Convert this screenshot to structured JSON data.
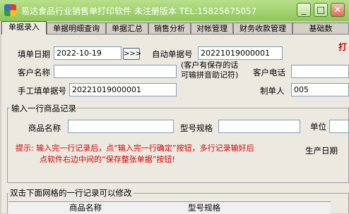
{
  "window": {
    "title": "易达食品行业销售单打印软件  未注册版本 TEL:15825675057",
    "minimize_glyph": "_",
    "maximize_glyph": "□",
    "close_glyph": "✕"
  },
  "tabs": [
    "单据录入",
    "单据明细查询",
    "单据汇总",
    "销售分析",
    "对帐管理",
    "财务收款管理",
    "基础数"
  ],
  "form": {
    "date_label": "填单日期",
    "date_value": "2022-10-19",
    "date_button": ">>>",
    "auto_no_label": "自动单据号",
    "auto_no_value": "20221019000001",
    "customer_label": "客户名称",
    "customer_value": "",
    "customer_hint": "(客户有保存的话\n可输拼音助记符)",
    "phone_label": "客户电话",
    "phone_value": "",
    "manual_no_label": "手工填单据号",
    "manual_no_value": "20221019000001",
    "creator_label": "制单人",
    "creator_value": "005",
    "right_edge_char": "打"
  },
  "item_entry": {
    "section_title": "输入一行商品记录",
    "product_label": "商品名称",
    "product_value": "",
    "spec_label": "型号规格",
    "spec_value": "",
    "unit_label": "单位",
    "unit_value": "",
    "tip_line1": "提示: 输入完一行记录后，点“输入完一行确定”按钮，多行记录输好后",
    "tip_line2": "点软件右边中间的“保存整张单据”按钮!",
    "production_date_label": "生产日期"
  },
  "grid": {
    "section_title": "双击下面网格的一行记录可以修改",
    "columns": [
      "商品名称",
      "型号规格"
    ]
  },
  "colors": {
    "title_bar": "#8fc65a",
    "tip_text": "#d00000"
  }
}
